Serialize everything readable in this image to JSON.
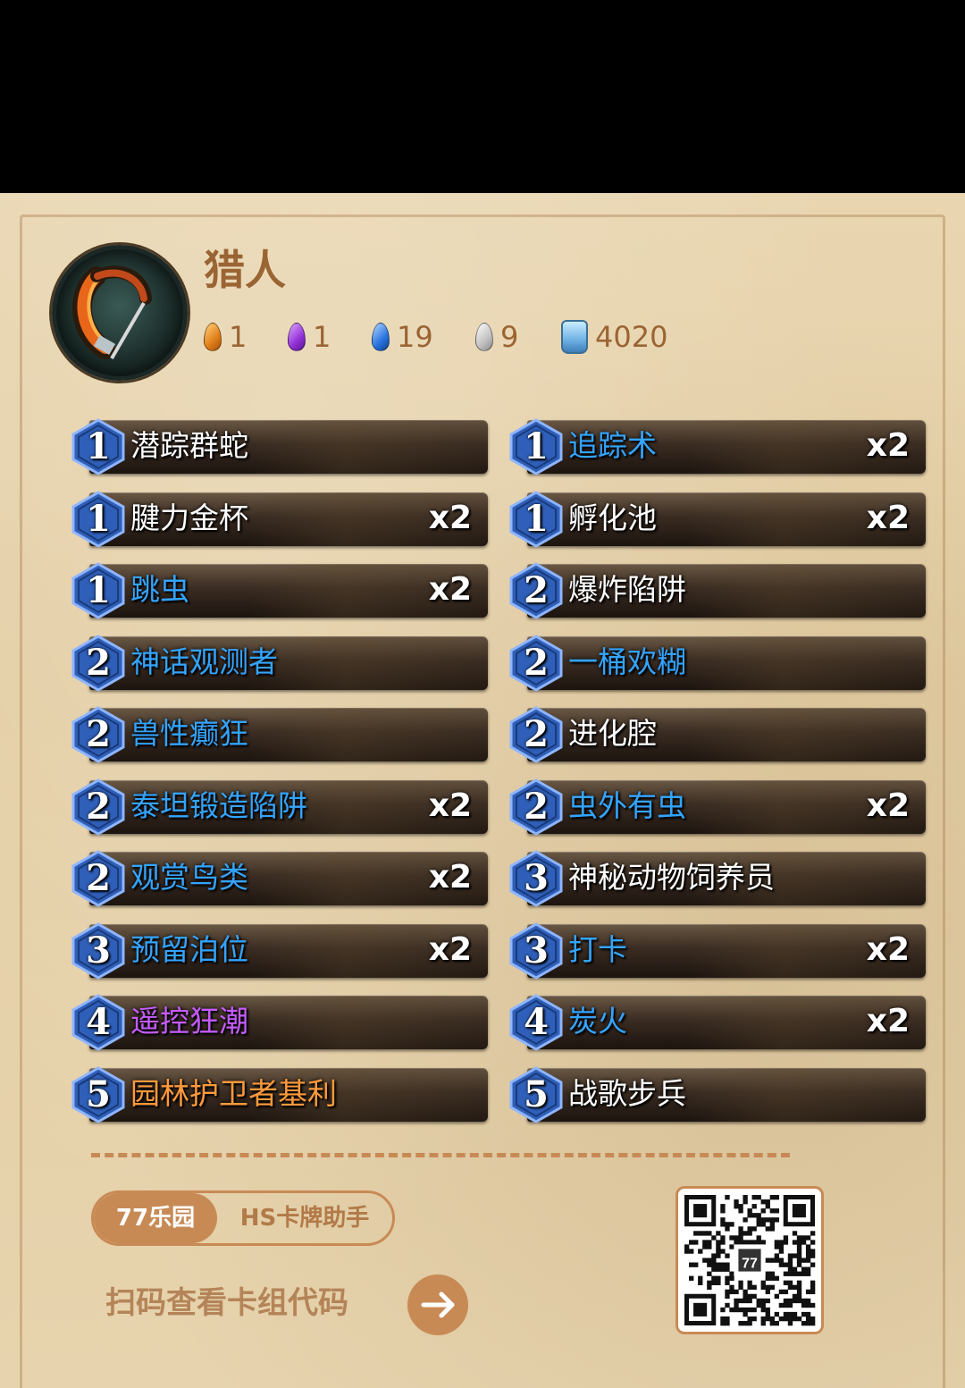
{
  "header": {
    "class_name": "猎人",
    "hero_portrait_icon": "hunter-bow-icon",
    "dust": [
      {
        "rarity": "legendary",
        "value": "1",
        "color": "#e2801a"
      },
      {
        "rarity": "epic",
        "value": "1",
        "color": "#9232d8"
      },
      {
        "rarity": "rare",
        "value": "19",
        "color": "#2a74e0"
      },
      {
        "rarity": "common",
        "value": "9",
        "color": "#c2c2c2"
      },
      {
        "rarity": "arcane-dust",
        "value": "4020",
        "color": "#6fb1e3"
      }
    ]
  },
  "cards_left": [
    {
      "cost": "1",
      "name": "潜踪群蛇",
      "count": "",
      "rarity": "common"
    },
    {
      "cost": "1",
      "name": "腱力金杯",
      "count": "x2",
      "rarity": "common"
    },
    {
      "cost": "1",
      "name": "跳虫",
      "count": "x2",
      "rarity": "rare"
    },
    {
      "cost": "2",
      "name": "神话观测者",
      "count": "",
      "rarity": "rare"
    },
    {
      "cost": "2",
      "name": "兽性癫狂",
      "count": "",
      "rarity": "rare"
    },
    {
      "cost": "2",
      "name": "泰坦锻造陷阱",
      "count": "x2",
      "rarity": "rare"
    },
    {
      "cost": "2",
      "name": "观赏鸟类",
      "count": "x2",
      "rarity": "rare"
    },
    {
      "cost": "3",
      "name": "预留泊位",
      "count": "x2",
      "rarity": "rare"
    },
    {
      "cost": "4",
      "name": "遥控狂潮",
      "count": "",
      "rarity": "epic"
    },
    {
      "cost": "5",
      "name": "园林护卫者基利",
      "count": "",
      "rarity": "legendary"
    }
  ],
  "cards_right": [
    {
      "cost": "1",
      "name": "追踪术",
      "count": "x2",
      "rarity": "rare"
    },
    {
      "cost": "1",
      "name": "孵化池",
      "count": "x2",
      "rarity": "common"
    },
    {
      "cost": "2",
      "name": "爆炸陷阱",
      "count": "",
      "rarity": "common"
    },
    {
      "cost": "2",
      "name": "一桶欢糊",
      "count": "",
      "rarity": "rare"
    },
    {
      "cost": "2",
      "name": "进化腔",
      "count": "",
      "rarity": "common"
    },
    {
      "cost": "2",
      "name": "虫外有虫",
      "count": "x2",
      "rarity": "rare"
    },
    {
      "cost": "3",
      "name": "神秘动物饲养员",
      "count": "",
      "rarity": "common"
    },
    {
      "cost": "3",
      "name": "打卡",
      "count": "x2",
      "rarity": "rare"
    },
    {
      "cost": "4",
      "name": "炭火",
      "count": "x2",
      "rarity": "rare"
    },
    {
      "cost": "5",
      "name": "战歌步兵",
      "count": "",
      "rarity": "common"
    }
  ],
  "footer": {
    "brand_left": "77乐园",
    "brand_right": "HS卡牌助手",
    "scan_text": "扫码查看卡组代码",
    "arrow_icon": "arrow-right-icon",
    "qr_icon": "qr-code-icon",
    "qr_logo_text": "77"
  }
}
